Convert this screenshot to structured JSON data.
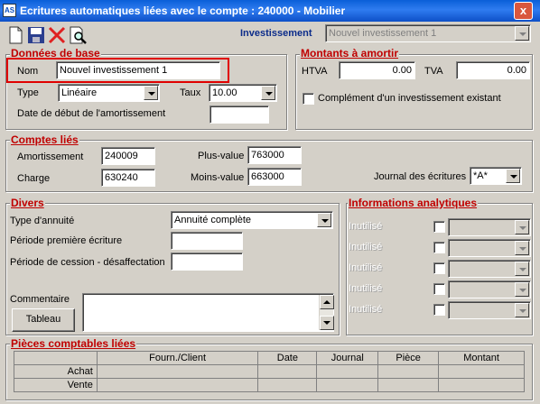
{
  "window": {
    "title": "Ecritures automatiques liées avec le compte : 240000 - Mobilier",
    "close_glyph": "x"
  },
  "toolbar": {
    "icons": [
      "new-document-icon",
      "save-icon",
      "delete-icon",
      "search-preview-icon"
    ],
    "investissement_label": "Investissement",
    "investissement_value": "Nouvel investissement 1"
  },
  "donnees_de_base": {
    "legend": "Données de base",
    "nom_label": "Nom",
    "nom_value": "Nouvel investissement 1",
    "type_label": "Type",
    "type_value": "Linéaire",
    "taux_label": "Taux",
    "taux_value": "10.00",
    "date_debut_label": "Date de début de l'amortissement",
    "date_debut_value": ""
  },
  "montants_a_amortir": {
    "legend": "Montants à amortir",
    "htva_label": "HTVA",
    "htva_value": "0.00",
    "tva_label": "TVA",
    "tva_value": "0.00",
    "complement_label": "Complément d'un investissement existant"
  },
  "comptes_lies": {
    "legend": "Comptes liés",
    "amortissement_label": "Amortissement",
    "amortissement_value": "240009",
    "charge_label": "Charge",
    "charge_value": "630240",
    "plus_value_label": "Plus-value",
    "plus_value_value": "763000",
    "moins_value_label": "Moins-value",
    "moins_value_value": "663000",
    "journal_label": "Journal des écritures",
    "journal_value": "*A*"
  },
  "divers": {
    "legend": "Divers",
    "type_annuite_label": "Type d'annuité",
    "type_annuite_value": "Annuité complète",
    "periode_premiere_label": "Période première écriture",
    "periode_premiere_value": "",
    "periode_cession_label": "Période de cession - désaffectation",
    "periode_cession_value": "",
    "commentaire_label": "Commentaire",
    "commentaire_value": "",
    "tableau_button": "Tableau"
  },
  "informations_analytiques": {
    "legend": "Informations analytiques",
    "rows": [
      {
        "label": "Inutilisé"
      },
      {
        "label": "Inutilisé"
      },
      {
        "label": "Inutilisé"
      },
      {
        "label": "Inutilisé"
      },
      {
        "label": "Inutilisé"
      }
    ]
  },
  "pieces_comptables": {
    "legend": "Pièces comptables liées",
    "columns": [
      "",
      "Fourn./Client",
      "Date",
      "Journal",
      "Pièce",
      "Montant"
    ],
    "rows": [
      {
        "label": "Achat"
      },
      {
        "label": "Vente"
      }
    ]
  },
  "colors": {
    "legend_red": "#c00000",
    "highlight_red": "#e00000",
    "titlebar_blue": "#0a5fd8",
    "face": "#d4d0c8"
  }
}
